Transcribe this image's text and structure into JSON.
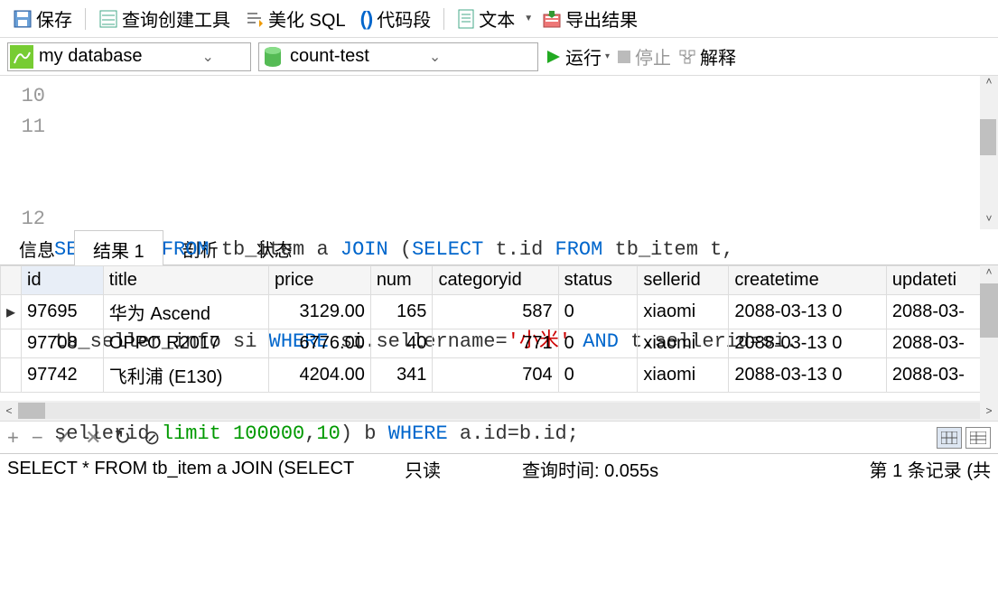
{
  "toolbar": {
    "save": "保存",
    "query_builder": "查询创建工具",
    "beautify": "美化 SQL",
    "snippet": "代码段",
    "text": "文本",
    "export": "导出结果"
  },
  "conn": {
    "db_dropdown": "my database",
    "schema_dropdown": "count-test",
    "run": "运行",
    "stop": "停止",
    "explain": "解释"
  },
  "editor": {
    "line10": "10",
    "line11": "11",
    "line12": "12",
    "sql_tokens": {
      "select": "SELECT",
      "star": " * ",
      "from": "FROM",
      "tb_item_a": " tb_item a ",
      "join": "JOIN",
      "lp": " (",
      "tid": " t.id ",
      "tb_item_t": " tb_item t,",
      "tbseller": "tb_seller_info si ",
      "where": "WHERE",
      "sname": " si.sellername=",
      "str": "'小米'",
      "and": " AND",
      "cond2": " t.sellerid=si.",
      "sellerid": "sellerid ",
      "limit": "limit",
      "num1": " 100000",
      "comma": ",",
      "num2": "10",
      "rp": ") b ",
      "abid": " a.id=b.id;"
    }
  },
  "tabs": {
    "info": "信息",
    "result": "结果 1",
    "profile": "剖析",
    "status": "状态"
  },
  "columns": [
    "id",
    "title",
    "price",
    "num",
    "categoryid",
    "status",
    "sellerid",
    "createtime",
    "updateti"
  ],
  "rows": [
    {
      "id": "97695",
      "title": "华为 Ascend",
      "price": "3129.00",
      "num": "165",
      "categoryid": "587",
      "status": "0",
      "sellerid": "xiaomi",
      "createtime": "2088-03-13 0",
      "updatetime": "2088-03-"
    },
    {
      "id": "97708",
      "title": "OPPO R2017",
      "price": "6776.00",
      "num": "40",
      "categoryid": "771",
      "status": "0",
      "sellerid": "xiaomi",
      "createtime": "2088-03-13 0",
      "updatetime": "2088-03-"
    },
    {
      "id": "97742",
      "title": "飞利浦 (E130)",
      "price": "4204.00",
      "num": "341",
      "categoryid": "704",
      "status": "0",
      "sellerid": "xiaomi",
      "createtime": "2088-03-13 0",
      "updatetime": "2088-03-"
    }
  ],
  "status_bar": {
    "sql_echo": "SELECT * FROM tb_item a JOIN (SELECT",
    "readonly": "只读",
    "query_time": "查询时间: 0.055s",
    "record": "第 1 条记录 (共"
  }
}
